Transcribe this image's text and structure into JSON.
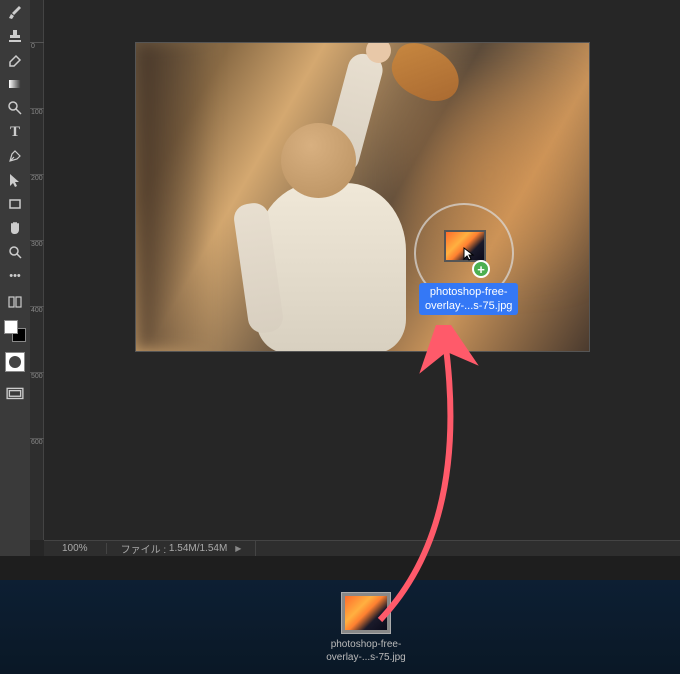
{
  "toolbar": {
    "tools": [
      {
        "name": "mixer-brush",
        "icon": "mixer"
      },
      {
        "name": "stamp",
        "icon": "stamp"
      },
      {
        "name": "eraser",
        "icon": "eraser"
      },
      {
        "name": "gradient",
        "icon": "gradient"
      },
      {
        "name": "dodge",
        "icon": "dodge"
      },
      {
        "name": "type",
        "icon": "T"
      },
      {
        "name": "pen",
        "icon": "pen"
      },
      {
        "name": "path-selection",
        "icon": "arrow"
      },
      {
        "name": "shape",
        "icon": "rect"
      },
      {
        "name": "hand",
        "icon": "hand"
      },
      {
        "name": "zoom",
        "icon": "magnify"
      },
      {
        "name": "more",
        "icon": "dots"
      }
    ]
  },
  "ruler": {
    "ticks": [
      "0",
      "100",
      "200",
      "300",
      "400",
      "500",
      "600"
    ]
  },
  "drag": {
    "filename_line1": "photoshop-free-",
    "filename_line2": "overlay-...s-75.jpg",
    "plus": "+"
  },
  "status": {
    "zoom": "100%",
    "file_label": "ファイル :",
    "file_size": "1.54M/1.54M"
  },
  "desktop": {
    "filename_line1": "photoshop-free-",
    "filename_line2": "overlay-...s-75.jpg"
  },
  "colors": {
    "accent": "#3478f6",
    "success": "#4caf50"
  }
}
